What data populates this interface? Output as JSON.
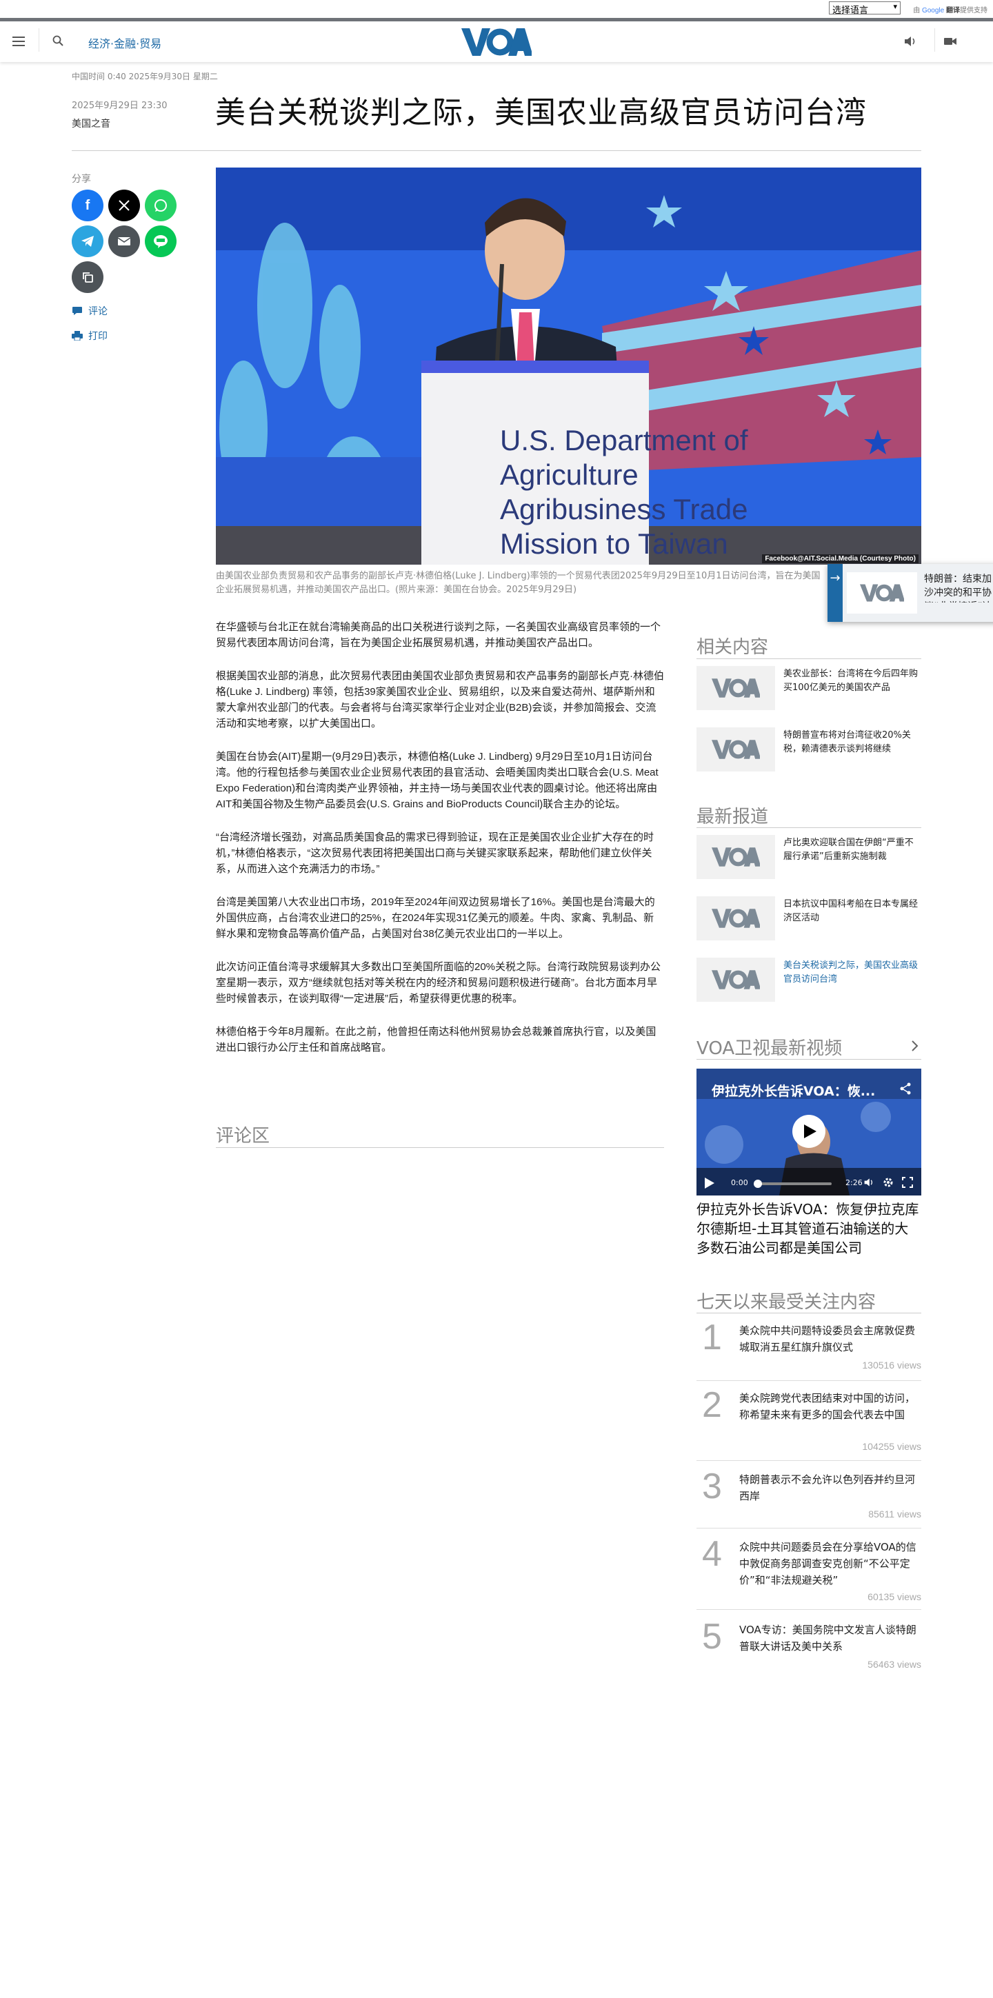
{
  "translate": {
    "select_label": "选择语言",
    "powered_by": "由",
    "google": "Google",
    "translate_word": "翻译",
    "powered_suffix": "提供支持"
  },
  "header": {
    "section": "经济·金融·贸易",
    "logo_text": "VOA"
  },
  "article": {
    "local_time": "中国时间 0:40 2025年9月30日 星期二",
    "date": "2025年9月29日 23:30",
    "author": "美国之音",
    "headline": "美台关税谈判之际，美国农业高级官员访问台湾",
    "share_label": "分享",
    "comment_link": "评论",
    "print_link": "打印",
    "hero_podium_text": [
      "U.S. Department of",
      "Agriculture",
      "Agribusiness Trade",
      "Mission to Taiwan"
    ],
    "hero_credit": "Facebook@AIT.Social.Media (Courtesy Photo)",
    "caption": "由美国农业部负责贸易和农产品事务的副部长卢克·林德伯格(Luke J. Lindberg)率领的一个贸易代表团2025年9月29日至10月1日访问台湾，旨在为美国企业拓展贸易机遇，并推动美国农产品出口。(照片来源：美国在台协会。2025年9月29日)",
    "paragraphs": [
      "在华盛顿与台北正在就台湾输美商品的出口关税进行谈判之际，一名美国农业高级官员率领的一个贸易代表团本周访问台湾，旨在为美国企业拓展贸易机遇，并推动美国农产品出口。",
      "根据美国农业部的消息，此次贸易代表团由美国农业部负责贸易和农产品事务的副部长卢克·林德伯格(Luke J. Lindberg) 率领，包括39家美国农业企业、贸易组织，以及来自爱达荷州、堪萨斯州和蒙大拿州农业部门的代表。与会者将与台湾买家举行企业对企业(B2B)会谈，并参加简报会、交流活动和实地考察，以扩大美国出口。",
      "美国在台协会(AIT)星期一(9月29日)表示，林德伯格(Luke J. Lindberg) 9月29日至10月1日访问台湾。他的行程包括参与美国农业企业贸易代表团的县官活动、会晤美国肉类出口联合会(U.S. Meat Expo Federation)和台湾肉类产业界领袖，并主持一场与美国农业代表的圆桌讨论。他还将出席由AIT和美国谷物及生物产品委员会(U.S. Grains and BioProducts Council)联合主办的论坛。",
      "“台湾经济增长强劲，对高品质美国食品的需求已得到验证，现在正是美国农业企业扩大存在的时机，”林德伯格表示，“这次贸易代表团将把美国出口商与关键买家联系起来，帮助他们建立伙伴关系，从而进入这个充满活力的市场。”",
      "台湾是美国第八大农业出口市场，2019年至2024年间双边贸易增长了16%。美国也是台湾最大的外国供应商，占台湾农业进口的25%，在2024年实现31亿美元的顺差。牛肉、家禽、乳制品、新鲜水果和宠物食品等高价值产品，占美国对台38亿美元农业出口的一半以上。",
      "此次访问正值台湾寻求缓解其大多数出口至美国所面临的20%关税之际。台湾行政院贸易谈判办公室星期一表示，双方“继续就包括对等关税在内的经济和贸易问题积极进行磋商”。台北方面本月早些时候曾表示，在谈判取得“一定进展”后，希望获得更优惠的税率。",
      "林德伯格于今年8月履新。在此之前，他曾担任南达科他州贸易协会总裁兼首席执行官，以及美国进出口银行办公厅主任和首席战略官。"
    ],
    "comment_section": "评论区"
  },
  "float_card": {
    "text": "特朗普：结束加沙冲突的和平协议“非常接近”达成"
  },
  "sidebar": {
    "related_title": "相关内容",
    "related": [
      {
        "text": "美农业部长：台湾将在今后四年购买100亿美元的美国农产品",
        "current": false
      },
      {
        "text": "特朗普宣布将对台湾征收20%关税，赖清德表示谈判将继续",
        "current": false
      }
    ],
    "latest_title": "最新报道",
    "latest": [
      {
        "text": "卢比奥欢迎联合国在伊朗“严重不履行承诺”后重新实施制裁",
        "current": false
      },
      {
        "text": "日本抗议中国科考船在日本专属经济区活动",
        "current": false
      },
      {
        "text": "美台关税谈判之际，美国农业高级官员访问台湾",
        "current": true
      }
    ],
    "video_section_title": "VOA卫视最新视频",
    "video": {
      "overlay_title": "伊拉克外长告诉VOA：恢...",
      "time_current": "0:00",
      "time_total": "2:26",
      "title": "伊拉克外长告诉VOA：恢复伊拉克库尔德斯坦-土耳其管道石油输送的大多数石油公司都是美国公司"
    },
    "popular_title": "七天以来最受关注内容",
    "popular": [
      {
        "rank": "1",
        "text": "美众院中共问题特设委员会主席敦促费城取消五星红旗升旗仪式",
        "views": "130516 views"
      },
      {
        "rank": "2",
        "text": "美众院跨党代表团结束对中国的访问，称希望未来有更多的国会代表去中国",
        "views": "104255 views"
      },
      {
        "rank": "3",
        "text": "特朗普表示不会允许以色列吞并约旦河西岸",
        "views": "85611 views"
      },
      {
        "rank": "4",
        "text": "众院中共问题委员会在分享给VOA的信中敦促商务部调查安克创新“不公平定价”和“非法规避关税”",
        "views": "60135 views"
      },
      {
        "rank": "5",
        "text": "VOA专访：美国务院中文发言人谈特朗普联大讲话及美中关系",
        "views": "56463 views"
      }
    ]
  },
  "colors": {
    "voa_blue": "#1d69a5",
    "facebook": "#1877f2",
    "x": "#000000",
    "whatsapp": "#25d366",
    "telegram": "#2ca5e0",
    "email": "#4d5358",
    "line": "#06c755",
    "copy": "#4d5358"
  }
}
